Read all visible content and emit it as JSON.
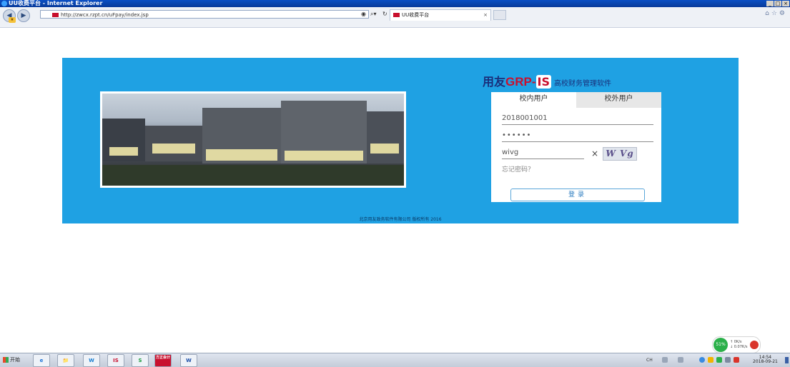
{
  "window": {
    "title": "UU收费平台 - Internet Explorer",
    "controls": [
      "_",
      "□",
      "×"
    ]
  },
  "browser": {
    "url": "http://zwcx.rzpt.cn/uFpay/index.jsp",
    "tab_title": "UU收费平台",
    "tab_close": "×",
    "nav_back": "◀",
    "nav_forward": "▶"
  },
  "banner": {
    "brand": "用友",
    "grp": "GRP",
    "dash": "-",
    "is_logo": "IS",
    "subtitle": "高校财务管理软件",
    "copyright": "北京用友政务软件有限公司 版权所有 2016",
    "bg_color": "#1fa1e3"
  },
  "login": {
    "tab_internal": "校内用户",
    "tab_external": "校外用户",
    "username": "2018001001",
    "password": "••••••",
    "captcha_input": "wivg",
    "captcha_clear": "×",
    "captcha_image_text": "W Vg",
    "forgot": "忘记密码？",
    "submit": "登录"
  },
  "netwidget": {
    "percent": "51%",
    "up": "↑ 0K/s",
    "down": "↓ 0.07K/s"
  },
  "taskbar": {
    "start": "开始",
    "apps": [
      "e",
      "📁",
      "W",
      "IS",
      "S",
      "方正会计",
      "W"
    ],
    "lang": "CH",
    "clock_time": "14:54",
    "clock_date": "2018-09-21"
  }
}
